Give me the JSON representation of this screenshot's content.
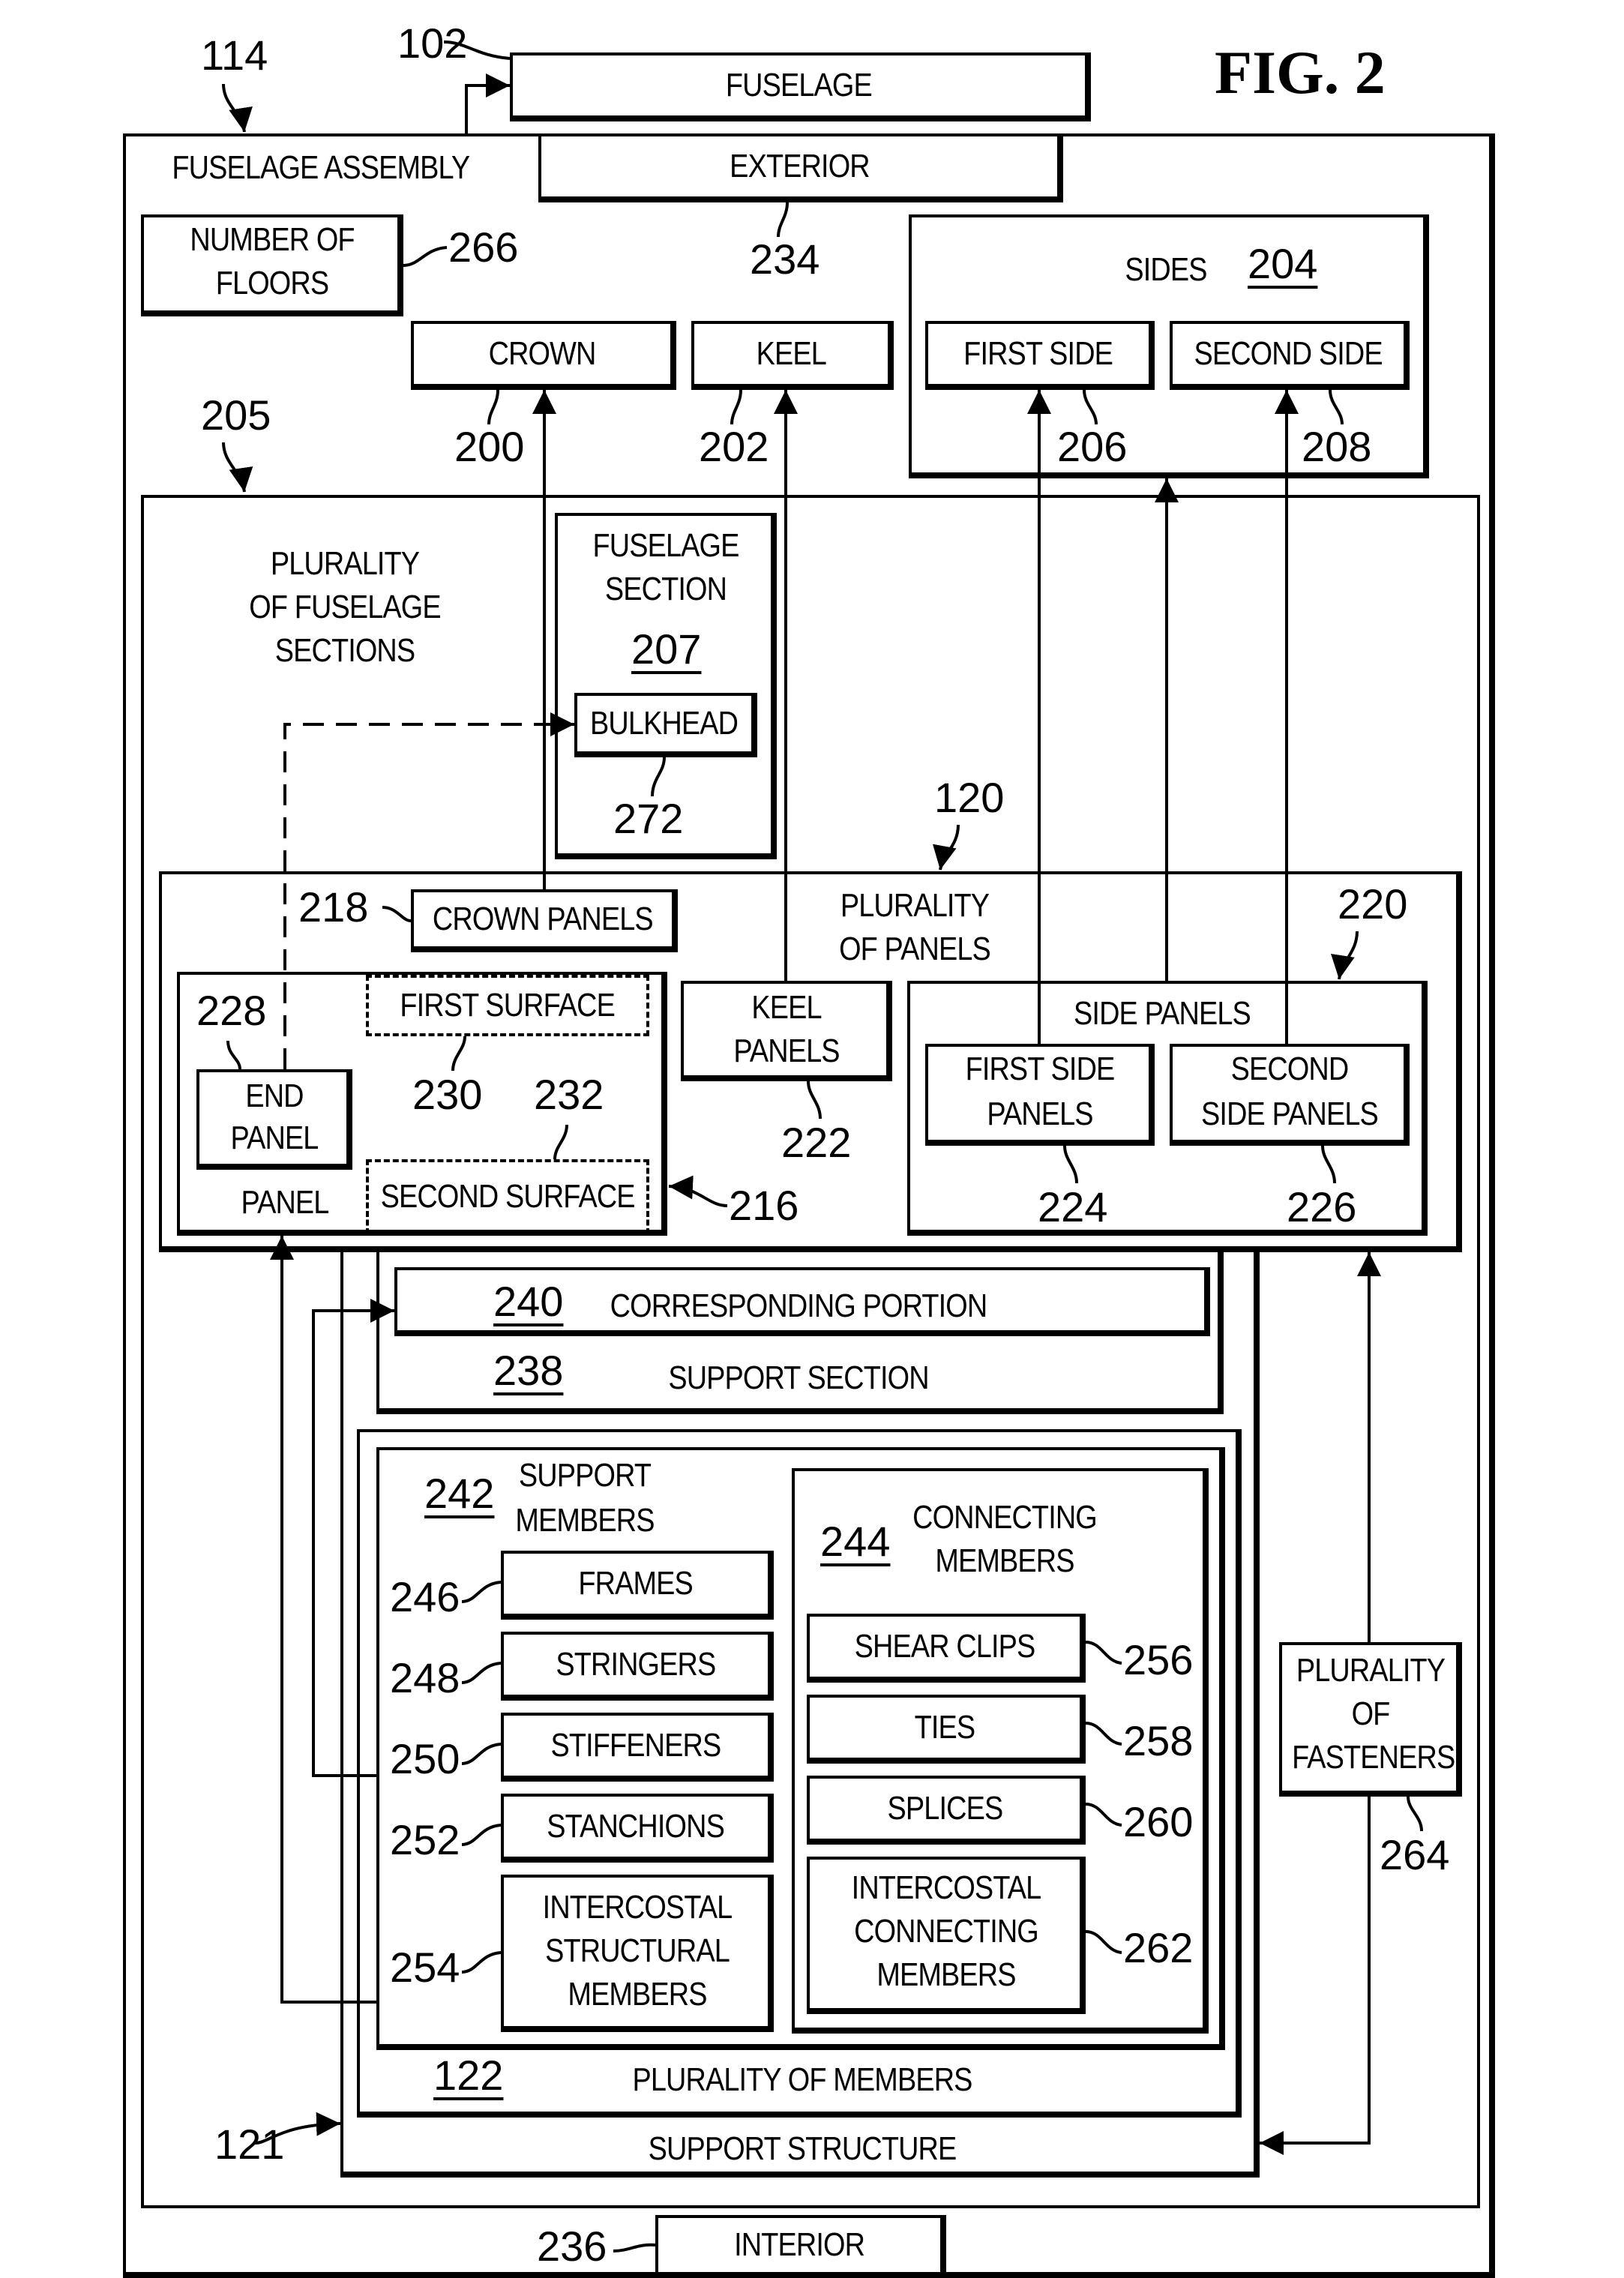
{
  "figure_title": "FIG. 2",
  "refs": {
    "fuselage_assembly": "114",
    "fuselage": "102",
    "exterior": "234",
    "number_of_floors": "266",
    "crown": "200",
    "keel": "202",
    "sides": "204",
    "first_side": "206",
    "second_side": "208",
    "plurality_of_fuselage_sections": "205",
    "fuselage_section": "207",
    "bulkhead": "272",
    "plurality_of_panels": "120",
    "crown_panels": "218",
    "side_panels": "220",
    "end_panel": "228",
    "first_surface": "230",
    "second_surface": "232",
    "panel": "216",
    "keel_panels": "222",
    "first_side_panels": "224",
    "second_side_panels": "226",
    "corresponding_portion": "240",
    "support_section": "238",
    "support_members": "242",
    "connecting_members": "244",
    "frames": "246",
    "stringers": "248",
    "stiffeners": "250",
    "stanchions": "252",
    "intercostal_structural_members": "254",
    "shear_clips": "256",
    "ties": "258",
    "splices": "260",
    "intercostal_connecting_members": "262",
    "plurality_of_fasteners": "264",
    "plurality_of_members": "122",
    "support_structure": "121",
    "interior": "236"
  },
  "labels": {
    "fuselage": "FUSELAGE",
    "fuselage_assembly": "FUSELAGE ASSEMBLY",
    "exterior": "EXTERIOR",
    "number_of_floors_1": "NUMBER OF",
    "number_of_floors_2": "FLOORS",
    "crown": "CROWN",
    "keel": "KEEL",
    "sides": "SIDES",
    "first_side": "FIRST SIDE",
    "second_side": "SECOND SIDE",
    "plurality_of_fuselage_sections_1": "PLURALITY",
    "plurality_of_fuselage_sections_2": "OF FUSELAGE",
    "plurality_of_fuselage_sections_3": "SECTIONS",
    "fuselage_section_1": "FUSELAGE",
    "fuselage_section_2": "SECTION",
    "bulkhead": "BULKHEAD",
    "plurality_of_panels_1": "PLURALITY",
    "plurality_of_panels_2": "OF PANELS",
    "crown_panels": "CROWN PANELS",
    "first_surface": "FIRST SURFACE",
    "second_surface": "SECOND SURFACE",
    "end_panel_1": "END",
    "end_panel_2": "PANEL",
    "panel": "PANEL",
    "keel_panels_1": "KEEL",
    "keel_panels_2": "PANELS",
    "side_panels": "SIDE PANELS",
    "first_side_panels_1": "FIRST SIDE",
    "first_side_panels_2": "PANELS",
    "second_side_panels_1": "SECOND",
    "second_side_panels_2": "SIDE PANELS",
    "corresponding_portion": "CORRESPONDING PORTION",
    "support_section": "SUPPORT SECTION",
    "support_members_1": "SUPPORT",
    "support_members_2": "MEMBERS",
    "connecting_members_1": "CONNECTING",
    "connecting_members_2": "MEMBERS",
    "frames": "FRAMES",
    "stringers": "STRINGERS",
    "stiffeners": "STIFFENERS",
    "stanchions": "STANCHIONS",
    "intercostal_structural_1": "INTERCOSTAL",
    "intercostal_structural_2": "STRUCTURAL",
    "intercostal_structural_3": "MEMBERS",
    "shear_clips": "SHEAR CLIPS",
    "ties": "TIES",
    "splices": "SPLICES",
    "intercostal_connecting_1": "INTERCOSTAL",
    "intercostal_connecting_2": "CONNECTING",
    "intercostal_connecting_3": "MEMBERS",
    "fasteners_1": "PLURALITY",
    "fasteners_2": "OF",
    "fasteners_3": "FASTENERS",
    "plurality_of_members": "PLURALITY OF MEMBERS",
    "support_structure": "SUPPORT STRUCTURE",
    "interior": "INTERIOR"
  }
}
